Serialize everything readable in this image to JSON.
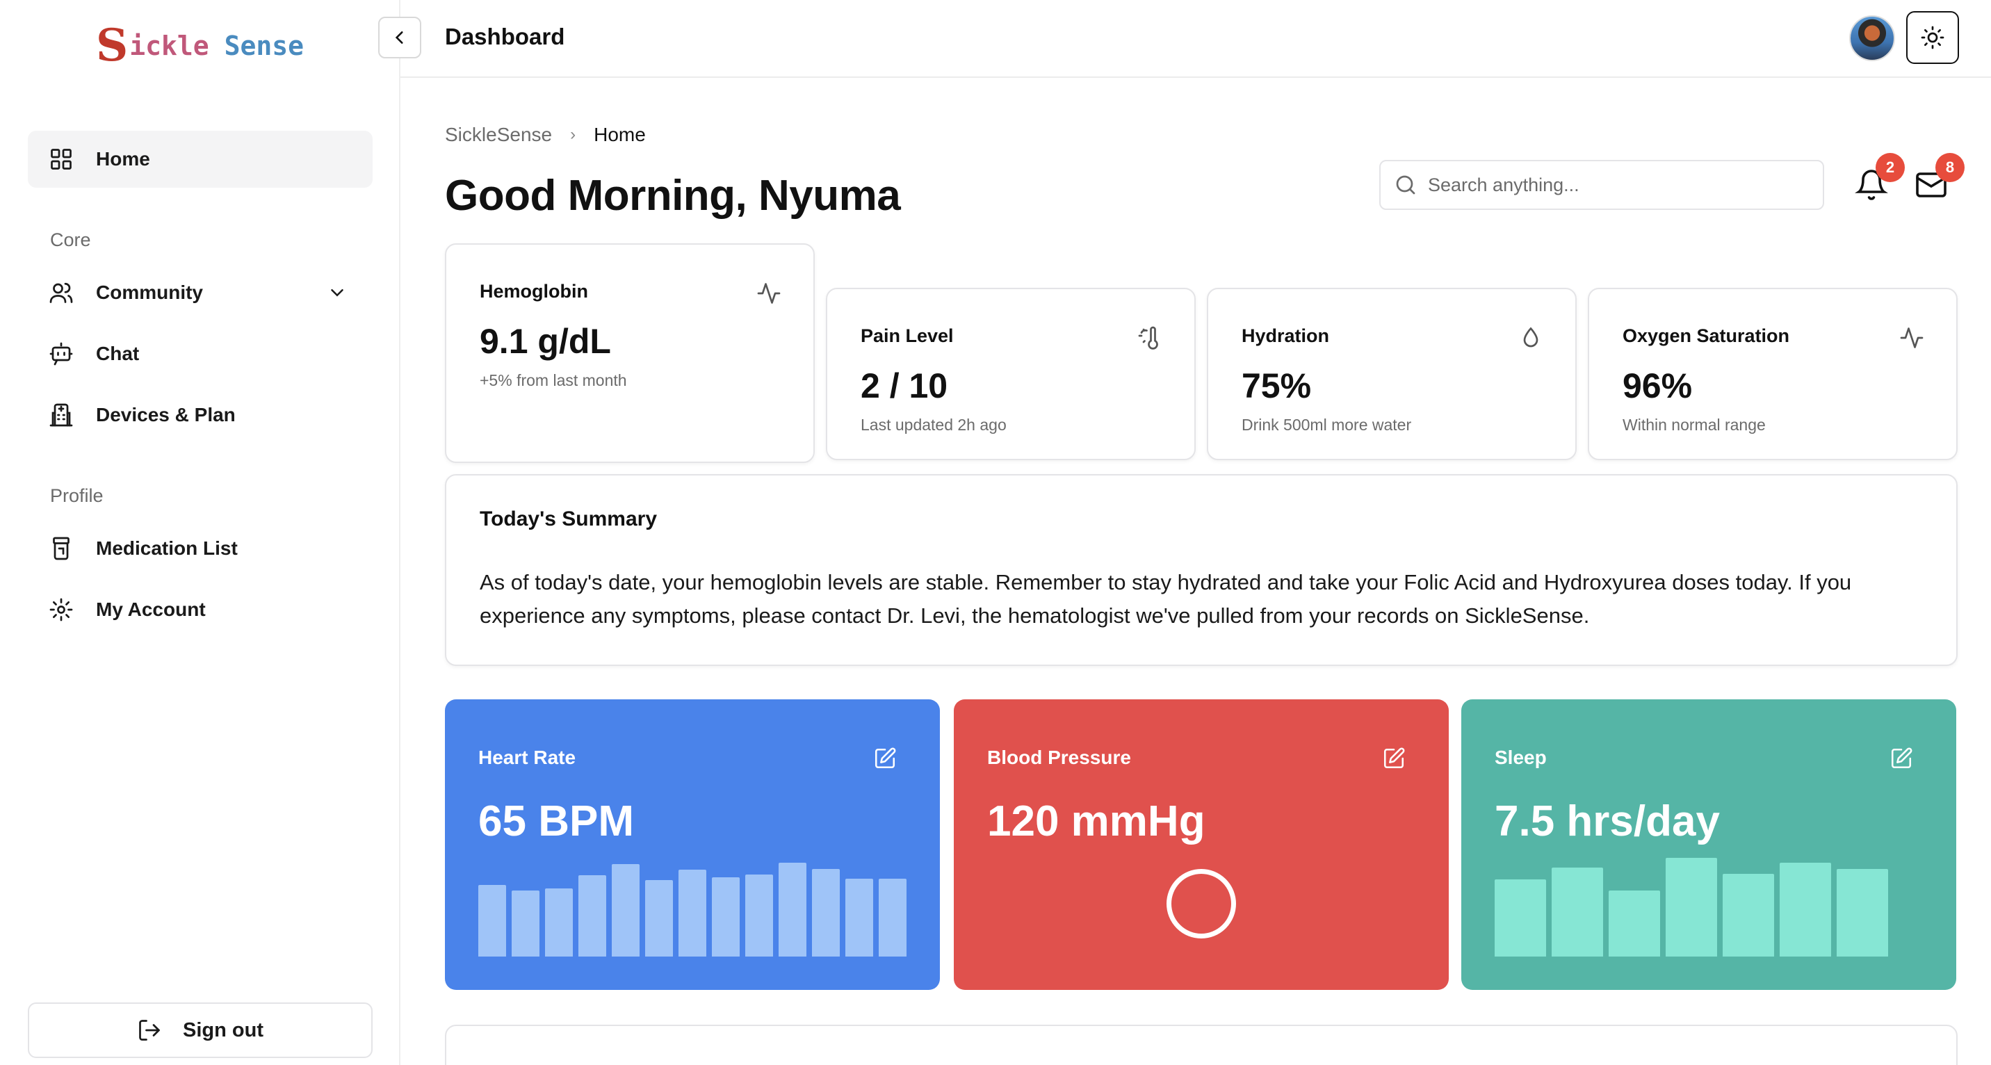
{
  "brand": {
    "logo_letter": "S",
    "logo_word1": "ickle",
    "logo_word2": "Sense"
  },
  "sidebar": {
    "home": "Home",
    "section_core": "Core",
    "core_items": [
      {
        "label": "Community",
        "icon": "users-icon"
      },
      {
        "label": "Chat",
        "icon": "bot-icon"
      },
      {
        "label": "Devices & Plan",
        "icon": "hospital-icon"
      }
    ],
    "section_profile": "Profile",
    "profile_items": [
      {
        "label": "Medication List",
        "icon": "pill-bottle-icon"
      },
      {
        "label": "My Account",
        "icon": "gear-icon"
      }
    ],
    "sign_out": "Sign out"
  },
  "topbar": {
    "title": "Dashboard"
  },
  "breadcrumb": {
    "root": "SickleSense",
    "current": "Home"
  },
  "greeting": "Good Morning, Nyuma",
  "search": {
    "placeholder": "Search anything..."
  },
  "notifications": {
    "count": "2"
  },
  "messages": {
    "count": "8"
  },
  "stats": [
    {
      "label": "Hemoglobin",
      "value": "9.1 g/dL",
      "sub": "+5% from last month",
      "icon": "activity-icon"
    },
    {
      "label": "Pain Level",
      "value": "2 / 10",
      "sub": "Last updated 2h ago",
      "icon": "thermometer-sun-icon"
    },
    {
      "label": "Hydration",
      "value": "75%",
      "sub": "Drink 500ml more water",
      "icon": "droplet-icon"
    },
    {
      "label": "Oxygen Saturation",
      "value": "96%",
      "sub": "Within normal range",
      "icon": "activity-icon"
    }
  ],
  "summary": {
    "title": "Today's Summary",
    "text": "As of today's date, your hemoglobin levels are stable. Remember to stay hydrated and take your Folic Acid and Hydroxyurea doses today. If you experience any symptoms, please contact Dr. Levi, the hematologist we've pulled from your records on SickleSense."
  },
  "metrics": {
    "heart_rate": {
      "label": "Heart Rate",
      "value": "65 BPM",
      "bar_values": [
        0.76,
        0.7,
        0.72,
        0.86,
        0.98,
        0.81,
        0.92,
        0.84,
        0.87,
        0.99,
        0.93,
        0.82,
        0.82
      ],
      "bar_color": "#9fc4f8"
    },
    "blood_pressure": {
      "label": "Blood Pressure",
      "value": "120 mmHg",
      "state": "loading"
    },
    "sleep": {
      "label": "Sleep",
      "value": "7.5 hrs/day",
      "bar_values": [
        0.78,
        0.9,
        0.67,
        1.0,
        0.84,
        0.95,
        0.89
      ],
      "bar_color": "#86e6d4"
    }
  },
  "colors": {
    "heart_rate": "#4a83ea",
    "blood_pressure": "#e0514d",
    "sleep": "#55b5a6",
    "badge": "#e74c3c"
  }
}
